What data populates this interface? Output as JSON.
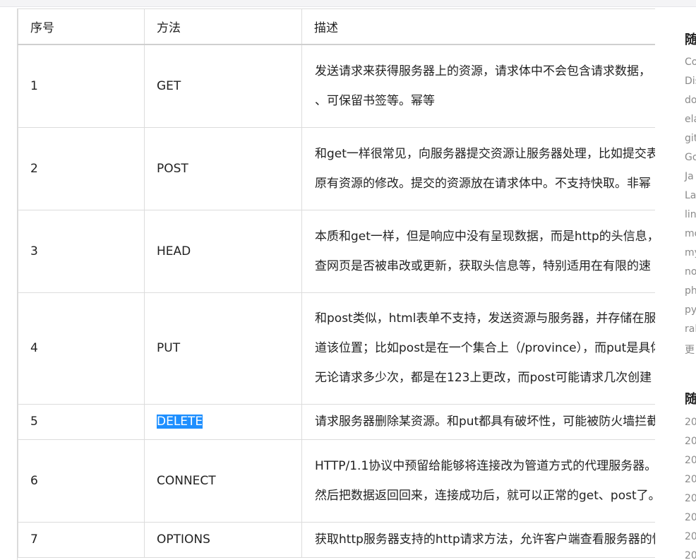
{
  "table": {
    "headers": [
      "序号",
      "方法",
      "描述"
    ],
    "rows": [
      {
        "no": "1",
        "method": "GET",
        "desc": [
          "发送请求来获得服务器上的资源，请求体中不会包含请求数据，",
          "、可保留书签等。幂等"
        ]
      },
      {
        "no": "2",
        "method": "POST",
        "desc": [
          "和get一样很常见，向服务器提交资源让服务器处理，比如提交表",
          "原有资源的修改。提交的资源放在请求体中。不支持快取。非幂"
        ]
      },
      {
        "no": "3",
        "method": "HEAD",
        "desc": [
          "本质和get一样，但是响应中没有呈现数据，而是http的头信息，",
          "查网页是否被串改或更新，获取头信息等，特别适用在有限的速"
        ]
      },
      {
        "no": "4",
        "method": "PUT",
        "desc": [
          "和post类似，html表单不支持，发送资源与服务器，并存储在服",
          "道该位置；比如post是在一个集合上（/province），而put是具体",
          "无论请求多少次，都是在123上更改，而post可能请求几次创建"
        ]
      },
      {
        "no": "5",
        "method": "DELETE",
        "desc": [
          "请求服务器删除某资源。和put都具有破坏性，可能被防火墙拦截"
        ]
      },
      {
        "no": "6",
        "method": "CONNECT",
        "desc": [
          "HTTP/1.1协议中预留给能够将连接改为管道方式的代理服务器。",
          "然后把数据返回回来，连接成功后，就可以正常的get、post了。"
        ]
      },
      {
        "no": "7",
        "method": "OPTIONS",
        "desc": [
          "获取http服务器支持的http请求方法，允许客户端查看服务器的性"
        ]
      }
    ]
  },
  "sidebar": {
    "heading1": "随",
    "tags": [
      "Co",
      "Dis",
      "do",
      "ela",
      "git",
      "Go",
      "Ja",
      "La",
      "lin",
      "mo",
      "my",
      "no",
      "ph",
      "py",
      "ral",
      "更"
    ],
    "heading2": "随",
    "dates": [
      "20",
      "20",
      "20",
      "20",
      "20",
      "20",
      "20",
      "20"
    ]
  },
  "colors": {
    "selection": "#1e8fff",
    "border": "#dcdcdc",
    "sidebar_text": "#8a8a8a"
  }
}
